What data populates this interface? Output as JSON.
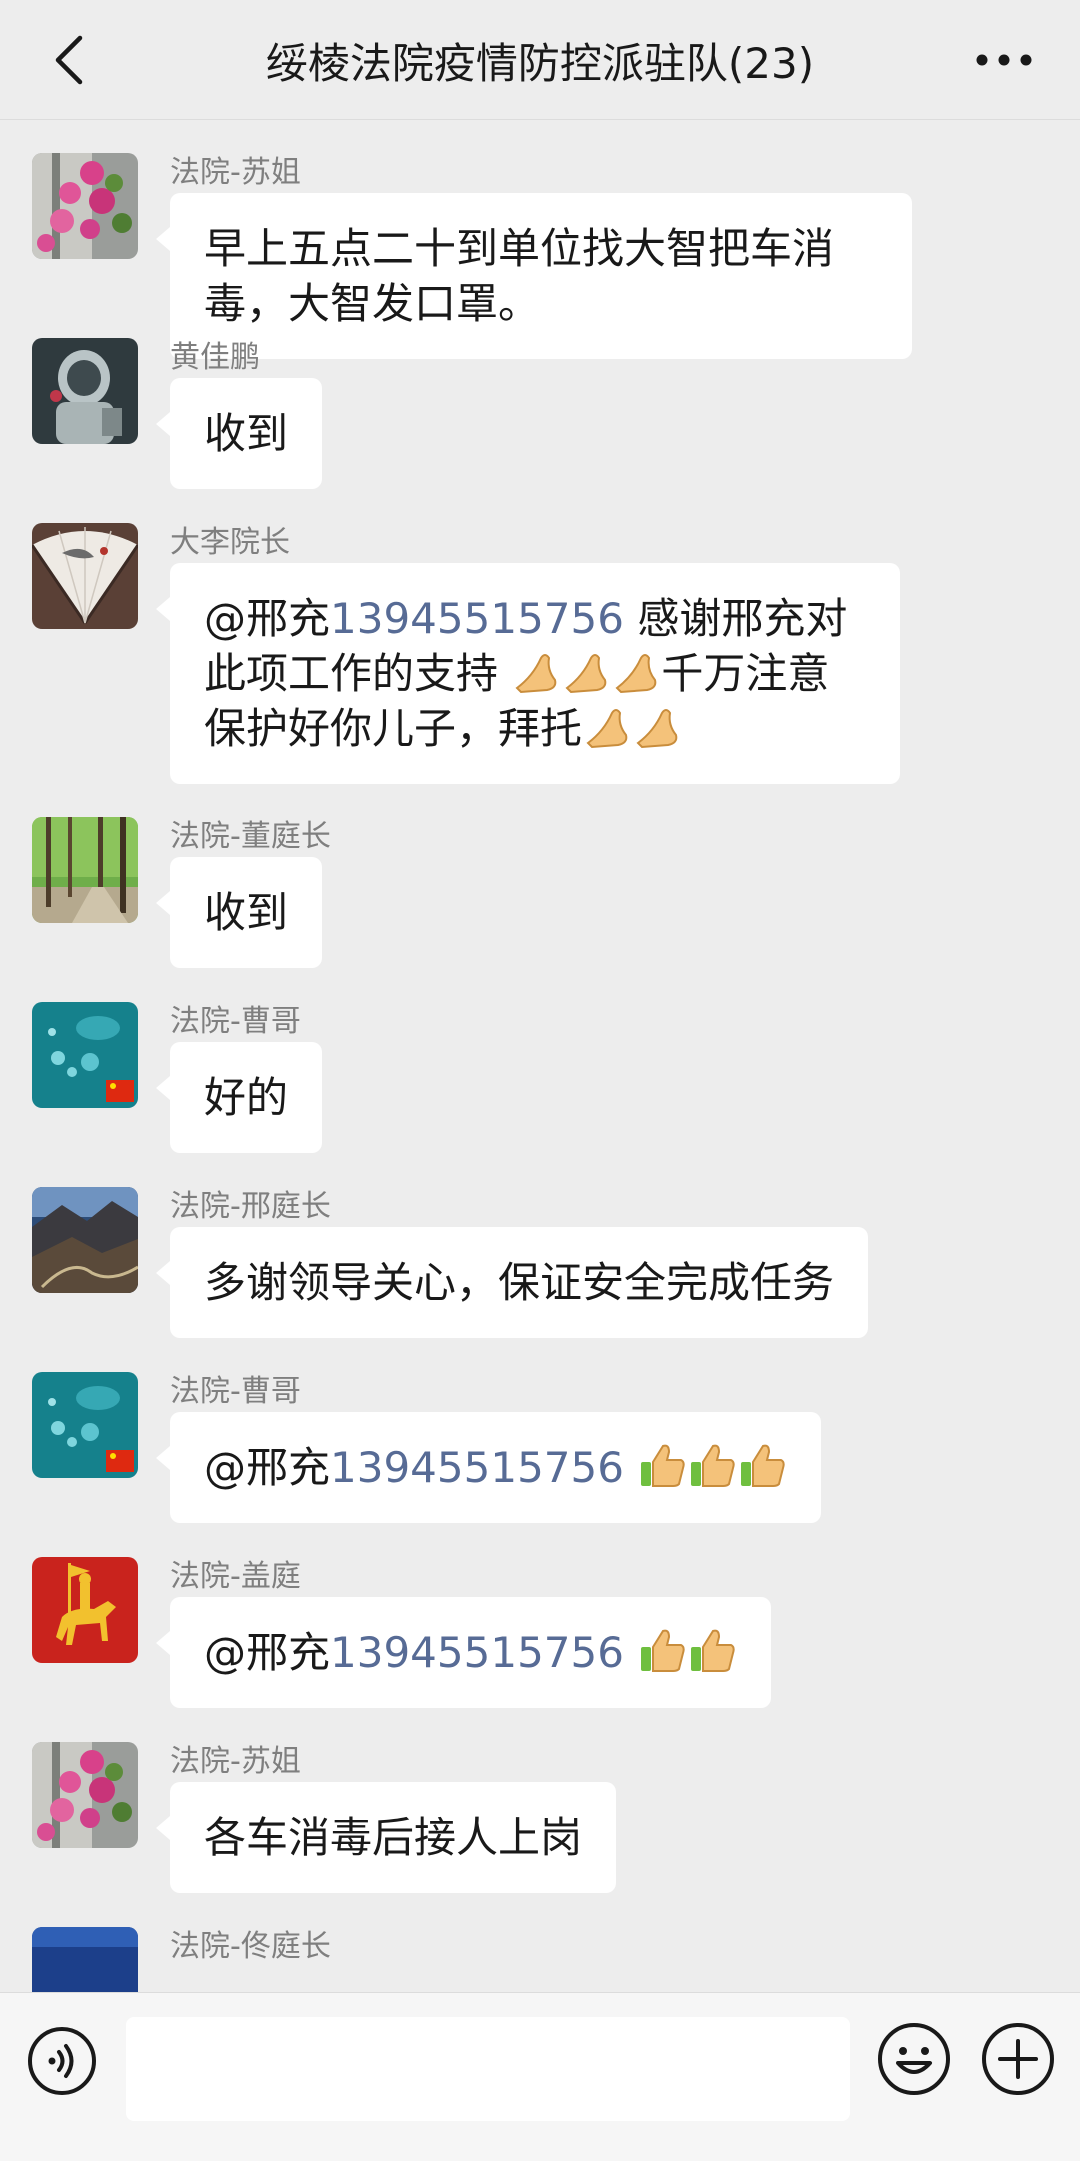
{
  "header": {
    "title": "绥棱法院疫情防控派驻队(23)",
    "back_icon": "chevron-left-icon",
    "more_icon": "more-dots-icon"
  },
  "messages": [
    {
      "sender": "法院-苏姐",
      "text": "早上五点二十到单位找大智把车消毒，大智发口罩。",
      "line1": "早上五点二十到单位找大智把车消",
      "line2": "毒，大智发口罩。"
    },
    {
      "sender": "黄佳鹏",
      "text": "收到"
    },
    {
      "sender": "大李院长",
      "mention": "@邢充",
      "phone": "13945515756",
      "line1_rest": " 感谢邢充对",
      "line2": "此项工作的支持",
      "line2_rest": "千万注意",
      "line3": "保护好你儿子，拜托"
    },
    {
      "sender": "法院-董庭长",
      "text": "收到"
    },
    {
      "sender": "法院-曹哥",
      "text": "好的"
    },
    {
      "sender": "法院-邢庭长",
      "text": "多谢领导关心，保证安全完成任务"
    },
    {
      "sender": "法院-曹哥",
      "mention": "@邢充",
      "phone": "13945515756"
    },
    {
      "sender": "法院-盖庭",
      "mention": "@邢充",
      "phone": "13945515756"
    },
    {
      "sender": "法院-苏姐",
      "text": "各车消毒后接人上岗"
    },
    {
      "sender": "法院-佟庭长"
    }
  ],
  "input_bar": {
    "voice_icon": "voice-icon",
    "emoji_icon": "smiley-icon",
    "plus_icon": "plus-circle-icon",
    "input_value": ""
  },
  "colors": {
    "background": "#ededed",
    "bubble": "#ffffff",
    "phone_link": "#576b95",
    "sender_name": "#7f7f7f"
  }
}
